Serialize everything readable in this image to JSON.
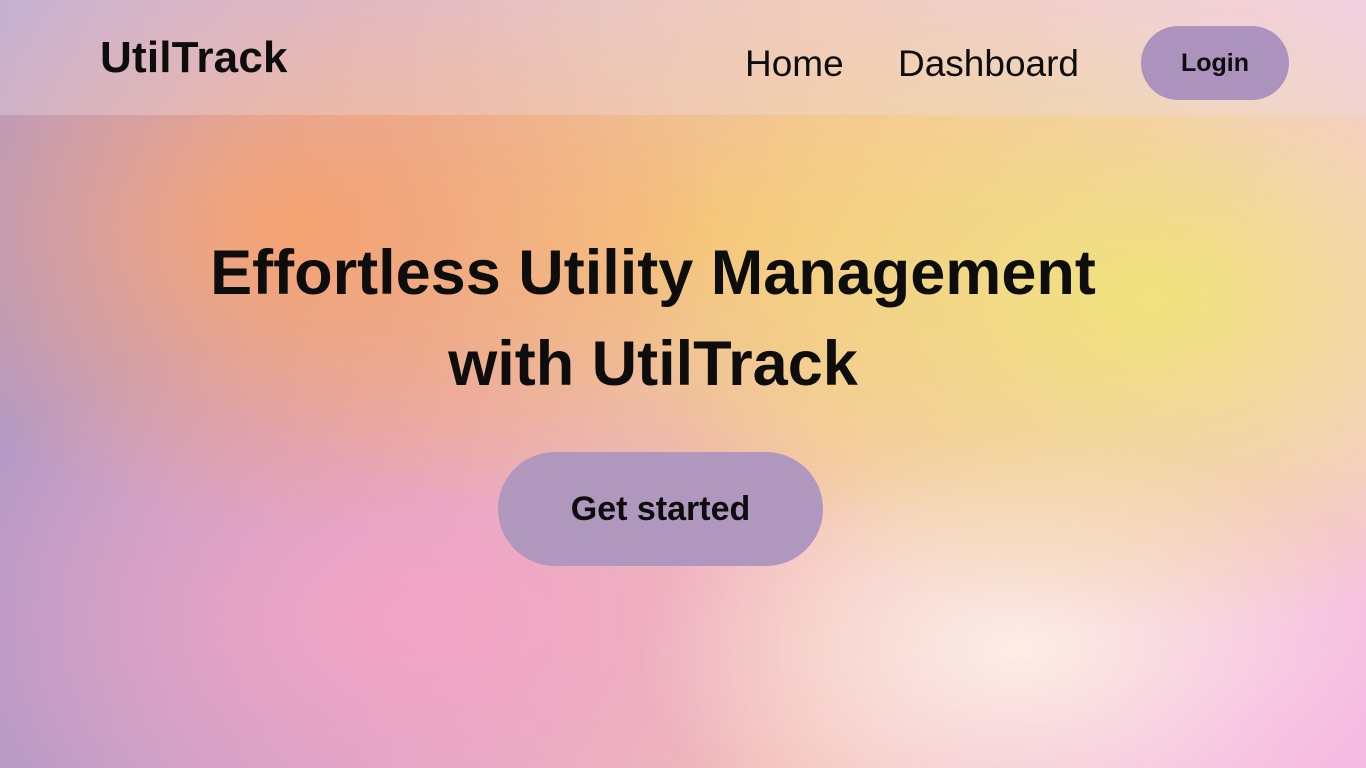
{
  "header": {
    "brand": "UtilTrack",
    "nav": {
      "home": "Home",
      "dashboard": "Dashboard"
    },
    "login_label": "Login"
  },
  "hero": {
    "title_line1": "Effortless Utility Management",
    "title_line2": "with UtilTrack",
    "cta_label": "Get started"
  },
  "colors": {
    "button_bg": "#ab93bd",
    "text": "#0d0d0d"
  }
}
